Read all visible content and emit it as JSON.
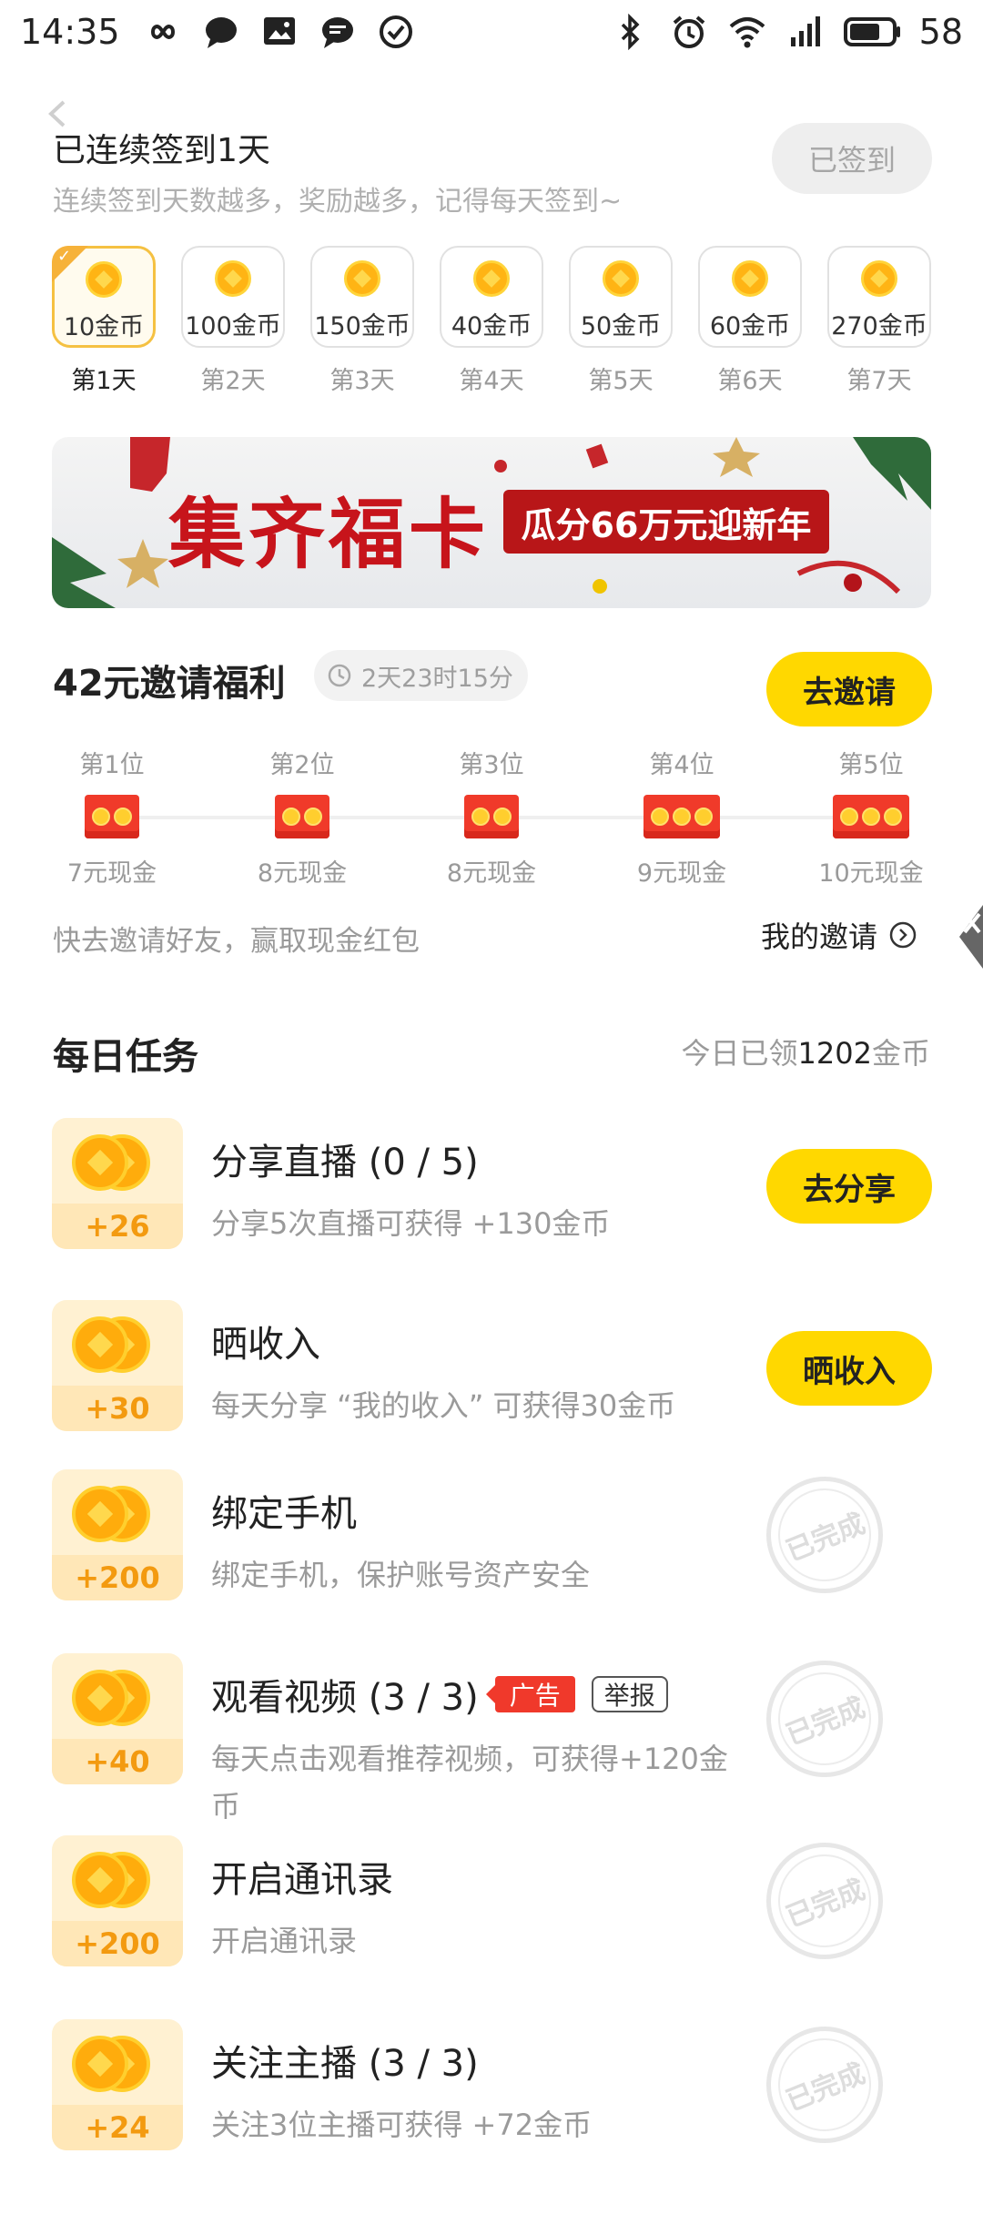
{
  "status_bar": {
    "time": "14:35",
    "battery": "58",
    "left_icons": [
      "infinity-icon",
      "chat-bubble-icon",
      "image-icon",
      "message-icon",
      "check-circle-icon"
    ],
    "right_icons": [
      "bluetooth-icon",
      "alarm-icon",
      "wifi-icon",
      "signal-icon",
      "battery-icon"
    ]
  },
  "checkin": {
    "title": "已连续签到1天",
    "subtitle": "连续签到天数越多，奖励越多，记得每天签到~",
    "button": "已签到",
    "days": [
      {
        "reward": "10金币",
        "label": "第1天",
        "active": true
      },
      {
        "reward": "100金币",
        "label": "第2天",
        "active": false
      },
      {
        "reward": "150金币",
        "label": "第3天",
        "active": false
      },
      {
        "reward": "40金币",
        "label": "第4天",
        "active": false
      },
      {
        "reward": "50金币",
        "label": "第5天",
        "active": false
      },
      {
        "reward": "60金币",
        "label": "第6天",
        "active": false
      },
      {
        "reward": "270金币",
        "label": "第7天",
        "active": false
      }
    ]
  },
  "banner": {
    "title": "集齐福卡",
    "subtitle": "瓜分66万元迎新年"
  },
  "invite": {
    "title": "42元邀请福利",
    "timer": "2天23时15分",
    "button": "去邀请",
    "ranks": [
      {
        "pos": "第1位",
        "prize": "7元现金",
        "coins": 2
      },
      {
        "pos": "第2位",
        "prize": "8元现金",
        "coins": 2
      },
      {
        "pos": "第3位",
        "prize": "8元现金",
        "coins": 2
      },
      {
        "pos": "第4位",
        "prize": "9元现金",
        "coins": 3
      },
      {
        "pos": "第5位",
        "prize": "10元现金",
        "coins": 3
      }
    ],
    "tip": "快去邀请好友，赢取现金红包",
    "my_invite": "我的邀请"
  },
  "tasks": {
    "title": "每日任务",
    "summary_prefix": "今日已领",
    "summary_value": "1202",
    "summary_suffix": "金币",
    "items": [
      {
        "bonus": "+26",
        "name": "分享直播 (0 / 5)",
        "desc": "分享5次直播可获得 +130金币",
        "button": "去分享",
        "done": false
      },
      {
        "bonus": "+30",
        "name": "晒收入",
        "desc": "每天分享 “我的收入” 可获得30金币",
        "button": "晒收入",
        "done": false
      },
      {
        "bonus": "+200",
        "name": "绑定手机",
        "desc": "绑定手机，保护账号资产安全",
        "done": true,
        "stamp": "已完成"
      },
      {
        "bonus": "+40",
        "name": "观看视频 (3 / 3)",
        "tag_ad": "广告",
        "tag_report": "举报",
        "desc": "每天点击观看推荐视频，可获得+120金币",
        "done": true,
        "stamp": "已完成"
      },
      {
        "bonus": "+200",
        "name": "开启通讯录",
        "desc": "开启通讯录",
        "done": true,
        "stamp": "已完成"
      },
      {
        "bonus": "+24",
        "name": "关注主播 (3 / 3)",
        "desc": "关注3位主播可获得 +72金币",
        "done": true,
        "stamp": "已完成"
      }
    ]
  },
  "colors": {
    "accent_yellow": "#ffd800",
    "coin_orange": "#ffac0c",
    "red": "#f0392b"
  }
}
